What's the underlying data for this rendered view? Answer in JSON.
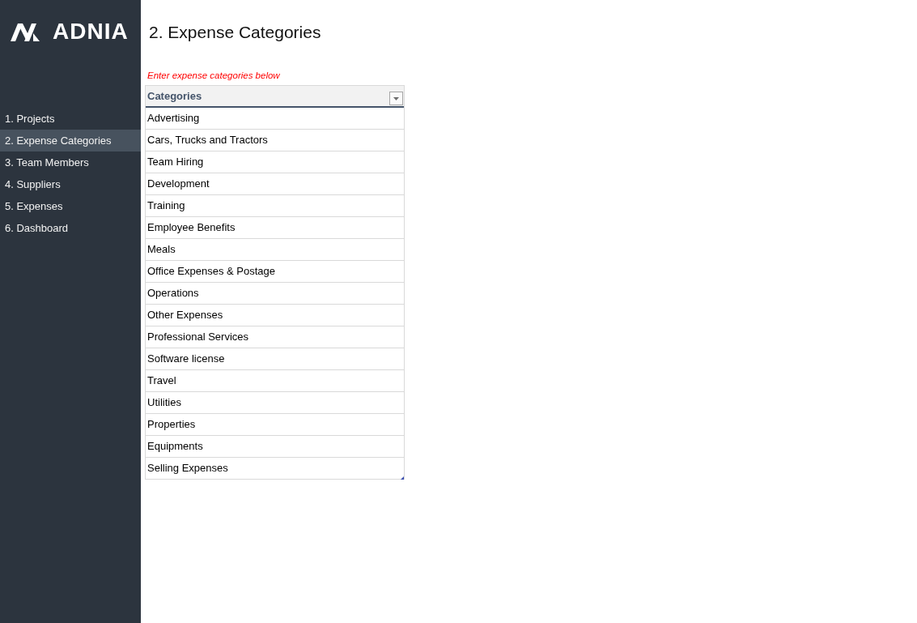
{
  "logo": {
    "text": "ADNIA"
  },
  "sidebar": {
    "items": [
      {
        "label": "1. Projects",
        "selected": false
      },
      {
        "label": "2. Expense Categories",
        "selected": true
      },
      {
        "label": "3. Team Members",
        "selected": false
      },
      {
        "label": "4. Suppliers",
        "selected": false
      },
      {
        "label": "5. Expenses",
        "selected": false
      },
      {
        "label": "6. Dashboard",
        "selected": false
      }
    ]
  },
  "page": {
    "title": "2. Expense Categories",
    "hint": "Enter expense categories below"
  },
  "table": {
    "columns": [
      "Categories"
    ],
    "rows": [
      [
        "Advertising"
      ],
      [
        "Cars, Trucks and Tractors"
      ],
      [
        "Team Hiring"
      ],
      [
        "Development"
      ],
      [
        "Training"
      ],
      [
        "Employee Benefits"
      ],
      [
        "Meals"
      ],
      [
        "Office Expenses & Postage"
      ],
      [
        "Operations"
      ],
      [
        "Other Expenses"
      ],
      [
        "Professional Services"
      ],
      [
        "Software license"
      ],
      [
        "Travel"
      ],
      [
        "Utilities"
      ],
      [
        "Properties"
      ],
      [
        "Equipments"
      ],
      [
        "Selling Expenses"
      ]
    ]
  }
}
